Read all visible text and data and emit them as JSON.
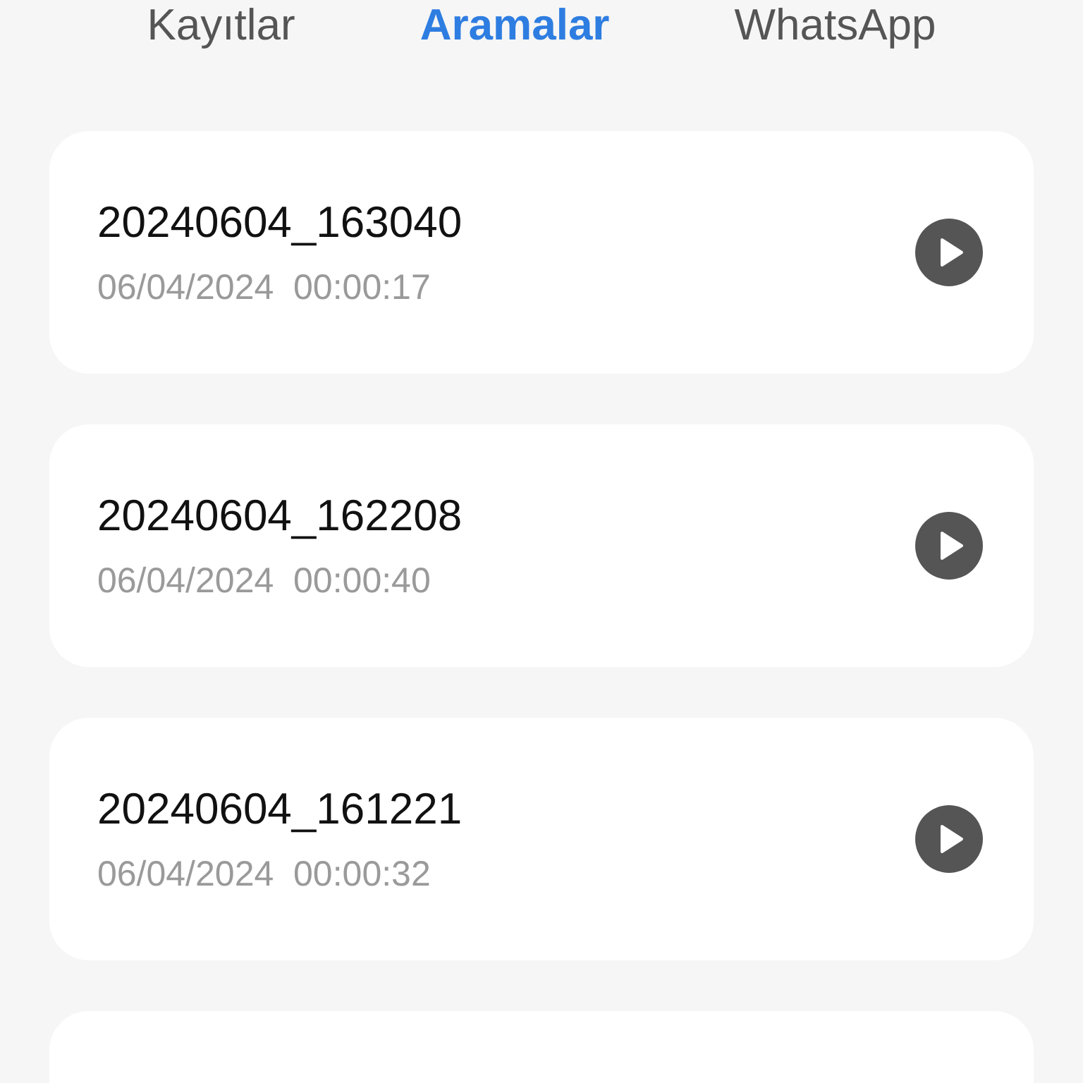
{
  "tabs": [
    {
      "label": "Kayıtlar",
      "selected": false
    },
    {
      "label": "Aramalar",
      "selected": true
    },
    {
      "label": "WhatsApp",
      "selected": false
    }
  ],
  "recordings": [
    {
      "name": "20240604_163040",
      "date": "06/04/2024",
      "duration": "00:00:17"
    },
    {
      "name": "20240604_162208",
      "date": "06/04/2024",
      "duration": "00:00:40"
    },
    {
      "name": "20240604_161221",
      "date": "06/04/2024",
      "duration": "00:00:32"
    }
  ]
}
